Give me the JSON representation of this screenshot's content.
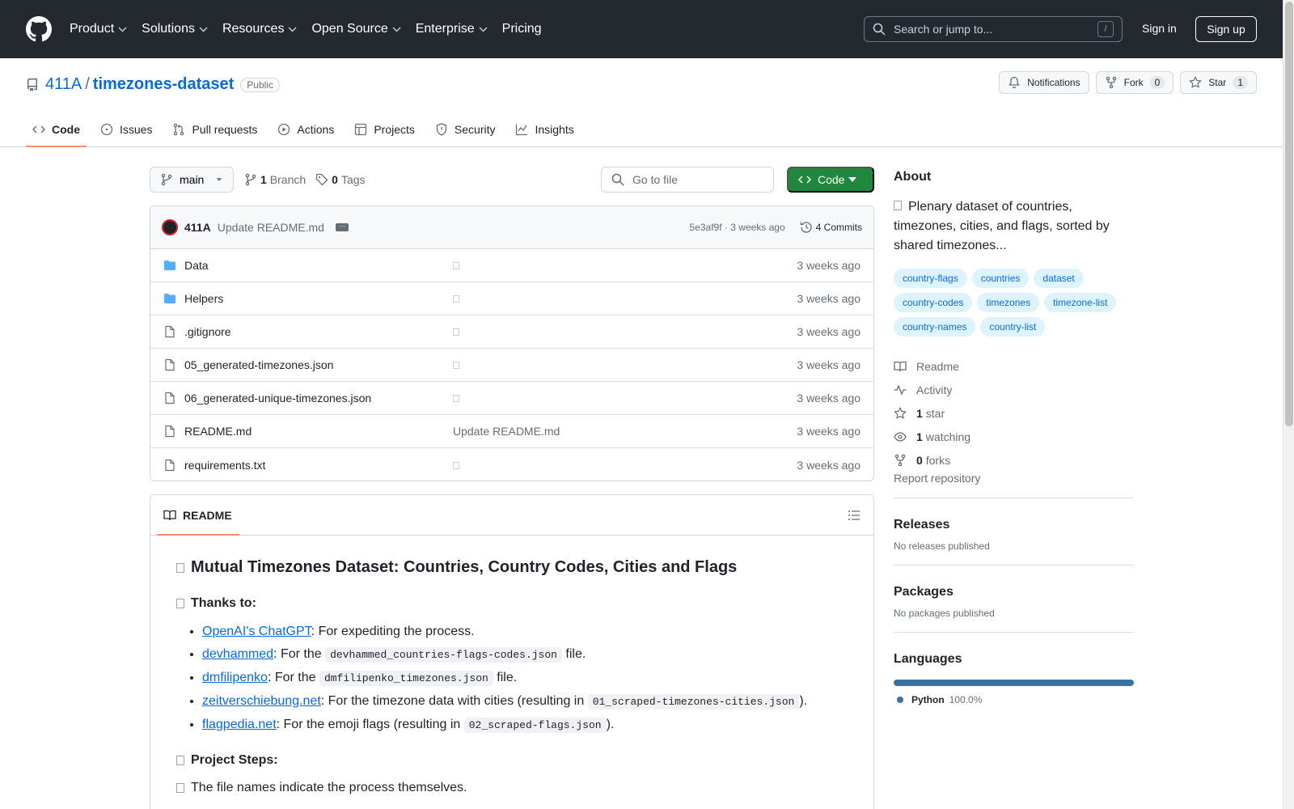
{
  "header": {
    "nav": [
      "Product",
      "Solutions",
      "Resources",
      "Open Source",
      "Enterprise",
      "Pricing"
    ],
    "search_placeholder": "Search or jump to...",
    "search_shortcut": "/",
    "sign_in": "Sign in",
    "sign_up": "Sign up"
  },
  "repo": {
    "owner": "411A",
    "separator": "/",
    "name": "timezones-dataset",
    "visibility": "Public",
    "actions": {
      "notifications": "Notifications",
      "fork": "Fork",
      "fork_count": "0",
      "star": "Star",
      "star_count": "1"
    },
    "tabs": [
      "Code",
      "Issues",
      "Pull requests",
      "Actions",
      "Projects",
      "Security",
      "Insights"
    ]
  },
  "toolbar": {
    "branch": "main",
    "branch_count": "1",
    "branch_label": "Branch",
    "tag_count": "0",
    "tag_label": "Tags",
    "goto_file": "Go to file",
    "code_button": "Code"
  },
  "commit": {
    "author": "411A",
    "message": "Update README.md",
    "hash": "5e3af9f",
    "sep": "·",
    "time": "3 weeks ago",
    "count_label": "4 Commits"
  },
  "files": [
    {
      "name": "Data",
      "type": "folder",
      "message": "",
      "date": "3 weeks ago"
    },
    {
      "name": "Helpers",
      "type": "folder",
      "message": "",
      "date": "3 weeks ago"
    },
    {
      "name": ".gitignore",
      "type": "file",
      "message": "",
      "date": "3 weeks ago"
    },
    {
      "name": "05_generated-timezones.json",
      "type": "file",
      "message": "",
      "date": "3 weeks ago"
    },
    {
      "name": "06_generated-unique-timezones.json",
      "type": "file",
      "message": "",
      "date": "3 weeks ago"
    },
    {
      "name": "README.md",
      "type": "file",
      "message": "Update README.md",
      "date": "3 weeks ago"
    },
    {
      "name": "requirements.txt",
      "type": "file",
      "message": "",
      "date": "3 weeks ago"
    }
  ],
  "readme": {
    "tab": "README",
    "title": "Mutual Timezones Dataset: Countries, Country Codes, Cities and Flags",
    "thanks_heading": "Thanks to:",
    "thanks": [
      {
        "link": "OpenAI's ChatGPT",
        "pre": ": For expediting the process.",
        "code": "",
        "post": ""
      },
      {
        "link": "devhammed",
        "pre": ": For the ",
        "code": "devhammed_countries-flags-codes.json",
        "post": " file."
      },
      {
        "link": "dmfilipenko",
        "pre": ": For the ",
        "code": "dmfilipenko_timezones.json",
        "post": " file."
      },
      {
        "link": "zeitverschiebung.net",
        "pre": ": For the timezone data with cities (resulting in ",
        "code": "01_scraped-timezones-cities.json",
        "post": ")."
      },
      {
        "link": "flagpedia.net",
        "pre": ": For the emoji flags (resulting in ",
        "code": "02_scraped-flags.json",
        "post": ")."
      }
    ],
    "steps_heading": "Project Steps:",
    "steps_text": "The file names indicate the process themselves."
  },
  "sidebar": {
    "about_title": "About",
    "description": "Plenary dataset of countries, timezones, cities, and flags, sorted by shared timezones...",
    "topics": [
      "country-flags",
      "countries",
      "dataset",
      "country-codes",
      "timezones",
      "timezone-list",
      "country-names",
      "country-list"
    ],
    "readme": "Readme",
    "activity": "Activity",
    "stars_count": "1",
    "stars_label": "star",
    "watching_count": "1",
    "watching_label": "watching",
    "forks_count": "0",
    "forks_label": "forks",
    "report": "Report repository",
    "releases_title": "Releases",
    "releases_empty": "No releases published",
    "packages_title": "Packages",
    "packages_empty": "No packages published",
    "languages_title": "Languages",
    "language_name": "Python",
    "language_pct": "100.0%",
    "language_fraction": 1.0,
    "language_color": "#3572A5"
  }
}
